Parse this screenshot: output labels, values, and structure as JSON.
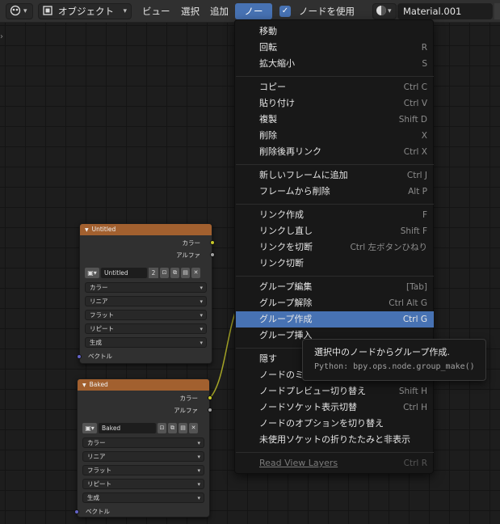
{
  "header": {
    "editor_type_icon": "node-editor-icon",
    "object_mode_icon": "object-mode-icon",
    "object_mode_label": "オブジェクト",
    "menus": [
      "ビュー",
      "選択",
      "追加",
      "ノード"
    ],
    "use_nodes_label": "ノードを使用",
    "use_nodes_checked": true,
    "material_icon": "material-sphere-icon",
    "material_name": "Material.001"
  },
  "nodes": [
    {
      "title": "Untitled",
      "outputs": [
        "カラー",
        "アルファ"
      ],
      "image_name": "Untitled",
      "user_count": "2",
      "selects": [
        "カラー",
        "リニア",
        "フラット",
        "リピート",
        "生成"
      ],
      "input": "ベクトル"
    },
    {
      "title": "Baked",
      "outputs": [
        "カラー",
        "アルファ"
      ],
      "image_name": "Baked",
      "selects": [
        "カラー",
        "リニア",
        "フラット",
        "リピート",
        "生成"
      ],
      "input": "ベクトル"
    }
  ],
  "menu": {
    "items": [
      {
        "label": "移動",
        "shortcut": ""
      },
      {
        "label": "回転",
        "shortcut": "R"
      },
      {
        "label": "拡大縮小",
        "shortcut": "S"
      },
      {
        "label": "コピー",
        "shortcut": "Ctrl C"
      },
      {
        "label": "貼り付け",
        "shortcut": "Ctrl V"
      },
      {
        "label": "複製",
        "shortcut": "Shift D"
      },
      {
        "label": "削除",
        "shortcut": "X"
      },
      {
        "label": "削除後再リンク",
        "shortcut": "Ctrl X"
      },
      {
        "label": "新しいフレームに追加",
        "shortcut": "Ctrl J"
      },
      {
        "label": "フレームから削除",
        "shortcut": "Alt P"
      },
      {
        "label": "リンク作成",
        "shortcut": "F"
      },
      {
        "label": "リンクし直し",
        "shortcut": "Shift F"
      },
      {
        "label": "リンクを切断",
        "shortcut": "Ctrl 左ボタンひねり"
      },
      {
        "label": "リンク切断",
        "shortcut": ""
      },
      {
        "label": "グループ編集",
        "shortcut": "[Tab]"
      },
      {
        "label": "グループ解除",
        "shortcut": "Ctrl Alt G"
      },
      {
        "label": "グループ作成",
        "shortcut": "Ctrl G"
      },
      {
        "label": "グループ挿入",
        "shortcut": ""
      },
      {
        "label": "隠す",
        "shortcut": ""
      },
      {
        "label": "ノードのミニ",
        "shortcut": ""
      },
      {
        "label": "ノードプレビュー切り替え",
        "shortcut": "Shift H"
      },
      {
        "label": "ノードソケット表示切替",
        "shortcut": "Ctrl H"
      },
      {
        "label": "ノードのオプションを切り替え",
        "shortcut": ""
      },
      {
        "label": "未使用ソケットの折りたたみと非表示",
        "shortcut": ""
      },
      {
        "label": "Read View Layers",
        "shortcut": "Ctrl R"
      }
    ],
    "highlighted": "グループ作成"
  },
  "tooltip": {
    "title": "選択中のノードからグループ作成.",
    "python": "Python: bpy.ops.node.group_make()"
  },
  "colors": {
    "accent": "#4772b3",
    "node_header": "#a2602f",
    "socket_color": "#c7c729",
    "socket_alpha": "#a1a1a1",
    "socket_vector": "#6363c7"
  }
}
